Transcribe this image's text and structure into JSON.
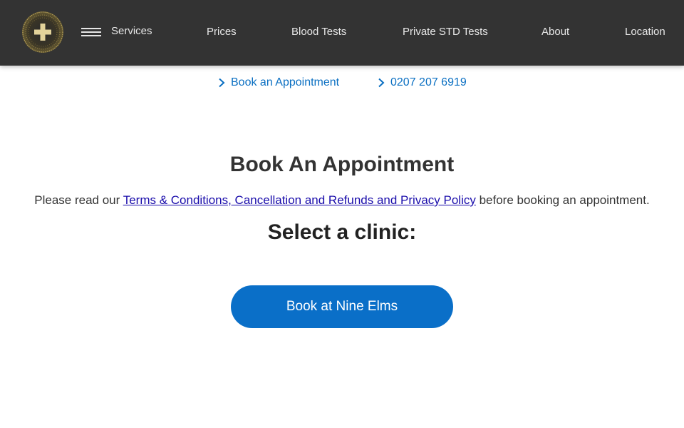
{
  "header": {
    "logo": "clinic-cross-logo",
    "menu_icon": "hamburger-menu-icon",
    "nav": {
      "services": "Services",
      "prices": "Prices",
      "blood_tests": "Blood Tests",
      "std_tests": "Private STD Tests",
      "about": "About",
      "location": "Location"
    }
  },
  "quicklinks": {
    "book": "Book an Appointment",
    "phone": "0207 207 6919",
    "icon": "chevron-right-icon"
  },
  "main": {
    "heading": "Book An Appointment",
    "terms_prefix": "Please read our ",
    "terms_link": "Terms & Conditions, Cancellation and Refunds and Privacy Policy",
    "terms_suffix": " before booking an appointment.",
    "select_clinic": "Select a clinic:",
    "book_button": "Book at Nine Elms"
  },
  "colors": {
    "navbar": "#333333",
    "link_blue": "#0a6fc2",
    "button_blue": "#0a6fc8",
    "logo_gold": "#c9b36a"
  }
}
